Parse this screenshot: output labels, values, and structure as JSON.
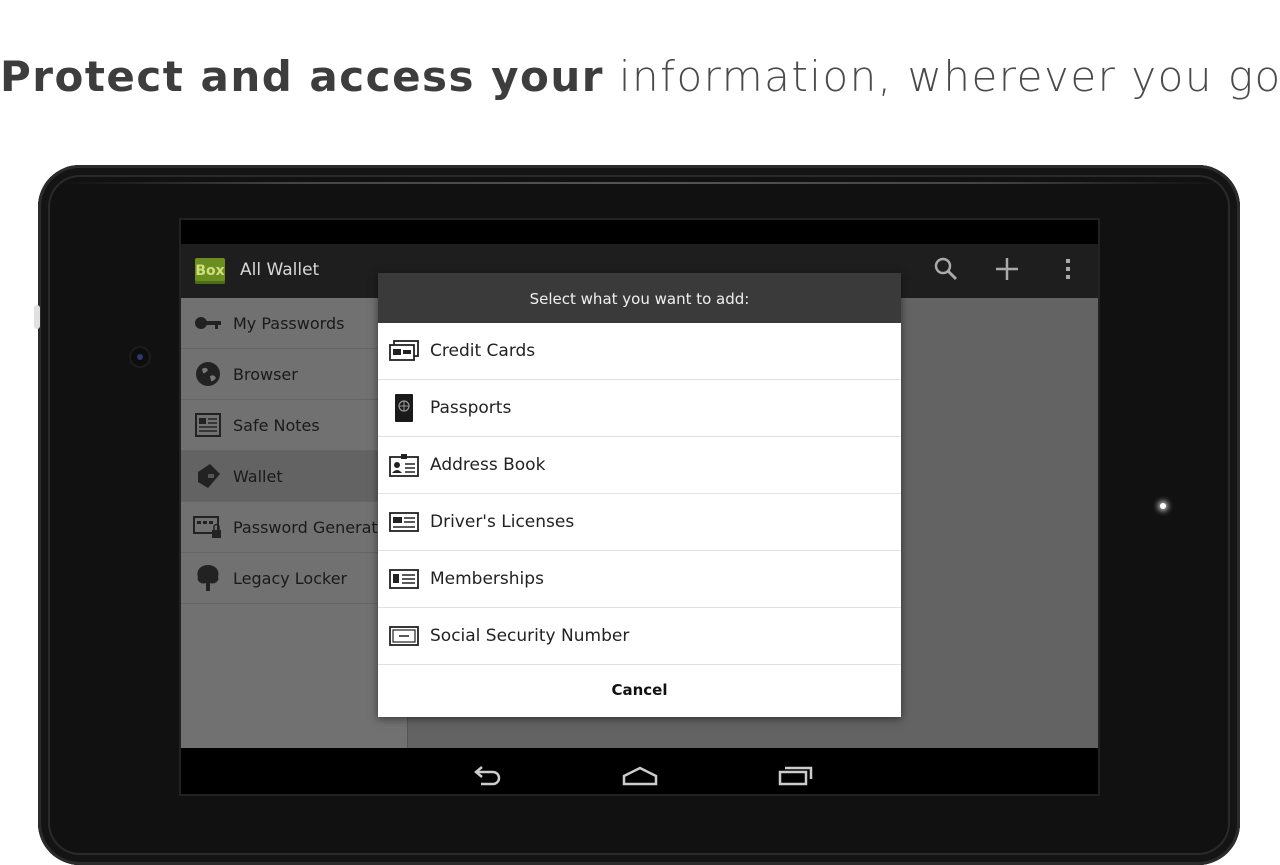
{
  "headline": {
    "bold": "Protect and access your",
    "light": "information, wherever you go"
  },
  "app": {
    "logo_text": "Box",
    "title": "All Wallet",
    "actions": [
      "search-icon",
      "add-icon",
      "overflow-menu-icon"
    ]
  },
  "sidebar": {
    "items": [
      {
        "label": "My Passwords",
        "icon": "key-icon"
      },
      {
        "label": "Browser",
        "icon": "globe-icon"
      },
      {
        "label": "Safe Notes",
        "icon": "note-icon"
      },
      {
        "label": "Wallet",
        "icon": "wallet-icon",
        "active": true
      },
      {
        "label": "Password Generator",
        "icon": "password-generator-icon"
      },
      {
        "label": "Legacy Locker",
        "icon": "tree-icon"
      }
    ]
  },
  "dialog": {
    "title": "Select what you want to add:",
    "options": [
      {
        "label": "Credit Cards",
        "icon": "credit-card-icon"
      },
      {
        "label": "Passports",
        "icon": "passport-icon"
      },
      {
        "label": "Address Book",
        "icon": "address-book-icon"
      },
      {
        "label": "Driver's Licenses",
        "icon": "drivers-license-icon"
      },
      {
        "label": "Memberships",
        "icon": "membership-card-icon"
      },
      {
        "label": "Social Security Number",
        "icon": "ssn-card-icon"
      }
    ],
    "cancel_label": "Cancel"
  },
  "system_nav": [
    "back-icon",
    "home-icon",
    "recent-apps-icon"
  ],
  "colors": {
    "dialog_header": "#3a3a3a",
    "action_bar": "#1e1e1e",
    "sidebar": "#717171",
    "logo_green": "#6b8e23"
  }
}
